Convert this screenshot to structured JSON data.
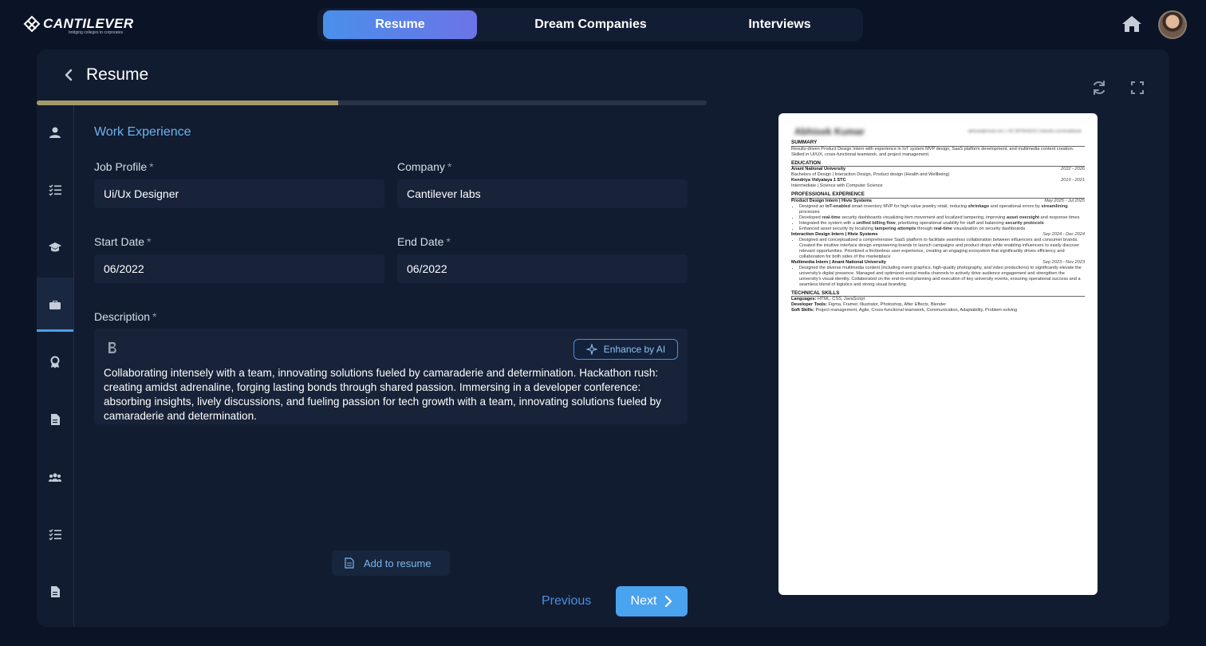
{
  "brand": {
    "name": "CANTILEVER",
    "tagline": "bridging colleges to corporates"
  },
  "topnav": {
    "tabs": [
      {
        "label": "Resume",
        "active": true
      },
      {
        "label": "Dream Companies",
        "active": false
      },
      {
        "label": "Interviews",
        "active": false
      }
    ]
  },
  "page": {
    "title": "Resume",
    "progress": 0.45,
    "section_title": "Work Experience"
  },
  "form": {
    "job_profile": {
      "label": "Job Profile",
      "value": "Ui/Ux Designer"
    },
    "company": {
      "label": "Company",
      "value": "Cantilever labs"
    },
    "start_date": {
      "label": "Start Date",
      "value": "06/2022"
    },
    "end_date": {
      "label": "End Date",
      "value": "06/2022"
    },
    "description": {
      "label": "Description",
      "enhance_label": "Enhance by AI",
      "value": "Collaborating intensely with a team, innovating solutions fueled by camaraderie and determination. Hackathon rush: creating amidst adrenaline, forging lasting bonds through shared passion. Immersing in a developer conference: absorbing insights, lively discussions, and fueling passion for tech growth with a team, innovating solutions fueled by camaraderie and determination."
    },
    "required_mark": "*",
    "add_label": "Add to resume",
    "prev_label": "Previous",
    "next_label": "Next"
  },
  "sidebar": {
    "icons": [
      "user-icon",
      "checklist-icon",
      "graduation-cap-icon",
      "briefcase-icon",
      "award-icon",
      "document-icon",
      "team-icon",
      "checklist-icon",
      "document-icon"
    ],
    "active_index": 3
  },
  "preview": {
    "name": "Abhisek Kumar",
    "contact": "abhisek@email.com | +91 9876543210 | linkedin.com/in/abhisek",
    "summary_title": "SUMMARY",
    "summary": "Results-driven Product Design Intern with experience in IoT system MVP design, SaaS platform development, and multimedia content creation. Skilled in UI/UX, cross-functional teamwork, and project management.",
    "education_title": "EDUCATION",
    "edu1": {
      "school": "Anant National University",
      "dates": "2022 - 2026",
      "detail": "Bachelors of Design | Interaction Design, Product design (Health and Wellbeing)"
    },
    "edu2": {
      "school": "Kendriya Vidyalaya 1 STC",
      "dates": "2019 - 2021",
      "detail": "Intermediate | Science with Computer Science"
    },
    "experience_title": "PROFESSIONAL EXPERIENCE",
    "job1": {
      "role": "Product Design Intern | Hivie Systems",
      "dates": "May 2025 - Jul 2025",
      "b1a": "Designed an ",
      "b1b": "IoT-enabled",
      "b1c": " smart inventory MVP for high-value jewelry retail, reducing ",
      "b1d": "shrinkage",
      "b1e": " and operational errors by ",
      "b1f": "streamlining",
      "b1g": " processes",
      "b2a": "Developed ",
      "b2b": "real-time",
      "b2c": " security dashboards visualizing item movement and localized tampering, improving ",
      "b2d": "asset oversight",
      "b2e": " and response times",
      "b3a": "Integrated the system with a ",
      "b3b": "unified billing flow",
      "b3c": ", prioritizing operational usability for staff and balancing ",
      "b3d": "security protocols",
      "b4a": "Enhanced asset security by localizing ",
      "b4b": "tampering attempts",
      "b4c": " through ",
      "b4d": "real-time",
      "b4e": " visualization on security dashboards"
    },
    "job2": {
      "role": "Interaction Design Intern | Hivie Systems",
      "dates": "Sep 2024 - Dec 2024",
      "b1": "Designed and conceptualized a comprehensive SaaS platform to facilitate seamless collaboration between influencers and consumer brands. Created the intuitive interface design empowering brands to launch campaigns and product drops while enabling influencers to easily discover relevant opportunities. Prioritized a frictionless user experience, creating an engaging ecosystem that significantly drives efficiency and collaboration for both sides of the marketplace"
    },
    "job3": {
      "role": "Multimedia Intern | Anant National University",
      "dates": "Sep 2023 - Nov 2023",
      "b1": "Designed the diverse multimedia content (including event graphics, high-quality photography, and video productions) to significantly elevate the university's digital presence. Managed and optimized social media channels to actively drive audience engagement and strengthen the university's visual identity. Collaborated on the end-to-end planning and execution of key university events, ensuring operational success and a seamless blend of logistics and strong visual branding."
    },
    "skills_title": "TECHNICAL SKILLS",
    "skills": [
      {
        "k": "Languages:",
        "v": " HTML, CSS, JavaScript"
      },
      {
        "k": "Developer Tools:",
        "v": " Figma, Framer, Illustrator, Photoshop, After Effects, Blender"
      },
      {
        "k": "Soft Skills:",
        "v": " Project management, Agile, Cross-functional teamwork, Communication, Adaptability, Problem-solving"
      }
    ]
  },
  "colors": {
    "accent": "#4aa3ef",
    "progress": "#a59a6a",
    "background": "#0b1426",
    "panel": "#111c31"
  }
}
